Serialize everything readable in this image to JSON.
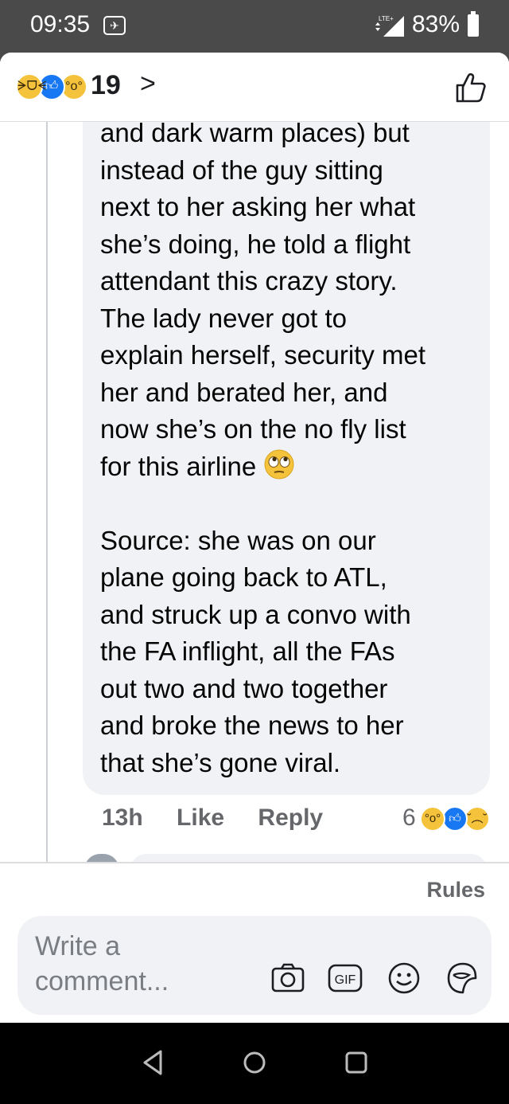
{
  "status_bar": {
    "time": "09:35",
    "signal_label": "LTE+",
    "battery_percent": "83%"
  },
  "header": {
    "reaction_icons": [
      "haha-icon",
      "like-icon",
      "wow-icon"
    ],
    "reaction_count": "19",
    "chevron": ">"
  },
  "comment": {
    "text_part1": "and dark warm places) but\ninstead of the guy sitting\nnext to her asking her what\nshe’s doing, he told a flight\nattendant this crazy story.\nThe lady never got to\nexplain herself, security met\nher and berated her, and\nnow she’s on the no fly list\nfor this airline ",
    "text_part1_emoji": "face-with-rolling-eyes-emoji",
    "text_part2": "\n\nSource: she was on our\nplane going back to ATL,\nand struck up a convo with\nthe FA inflight, all the FAs\nout two and two together\nand broke the news to her\nthat she’s gone viral.",
    "time_ago": "13h",
    "like_label": "Like",
    "reply_label": "Reply",
    "reaction_count": "6",
    "reaction_icons": [
      "wow-icon",
      "like-icon",
      "sad-icon"
    ]
  },
  "footer": {
    "rules_label": "Rules",
    "composer_placeholder": "Write a comment...",
    "composer_icons": [
      "camera-icon",
      "gif-icon",
      "emoji-icon",
      "sticker-icon"
    ]
  },
  "colors": {
    "bubble_bg": "#f0f2f5",
    "meta_text": "#65676b",
    "like_blue": "#1877f2",
    "reaction_yellow": "#f5c33b"
  }
}
